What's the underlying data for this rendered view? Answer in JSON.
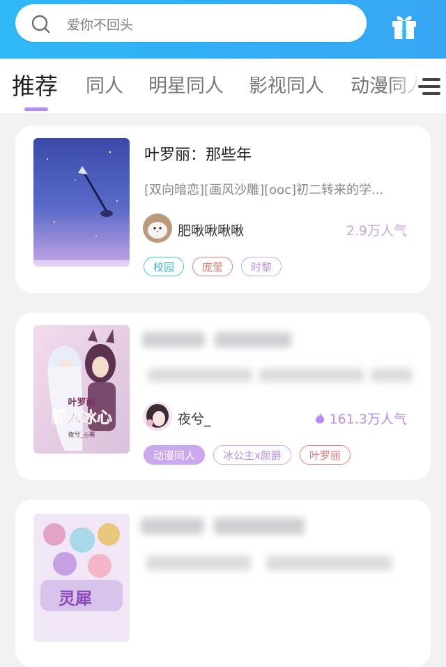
{
  "search": {
    "query": "爱你不回头"
  },
  "tabs": [
    "推荐",
    "同人",
    "明星同人",
    "影视同人",
    "动漫同人"
  ],
  "books": [
    {
      "title": "叶罗丽：那些年",
      "description": "[双向暗恋][画风沙雕][ooc]初二转来的学...",
      "author": "肥啾啾啾啾",
      "popularity": "2.9万人气",
      "tags": [
        "校园",
        "庞莹",
        "时黎"
      ]
    },
    {
      "author": "夜兮_",
      "popularity": "161.3万人气",
      "tags": [
        "动漫同人",
        "冰公主x颜爵",
        "叶罗丽"
      ],
      "cover_title": "叶罗丽 爵入冰心",
      "cover_credit": "夜兮_◎著"
    },
    {
      "cover_title": "灵犀"
    }
  ],
  "colors": {
    "topbar": "#2fb8f6",
    "accent": "#b48cf0",
    "popularity": "#c5a7ee",
    "tag_cyan": "#4bc4e8",
    "tag_red": "#e8857d",
    "tag_purple": "#c9a8ee"
  },
  "icons": [
    "search-icon",
    "gift-icon",
    "menu-icon",
    "flame-icon"
  ]
}
